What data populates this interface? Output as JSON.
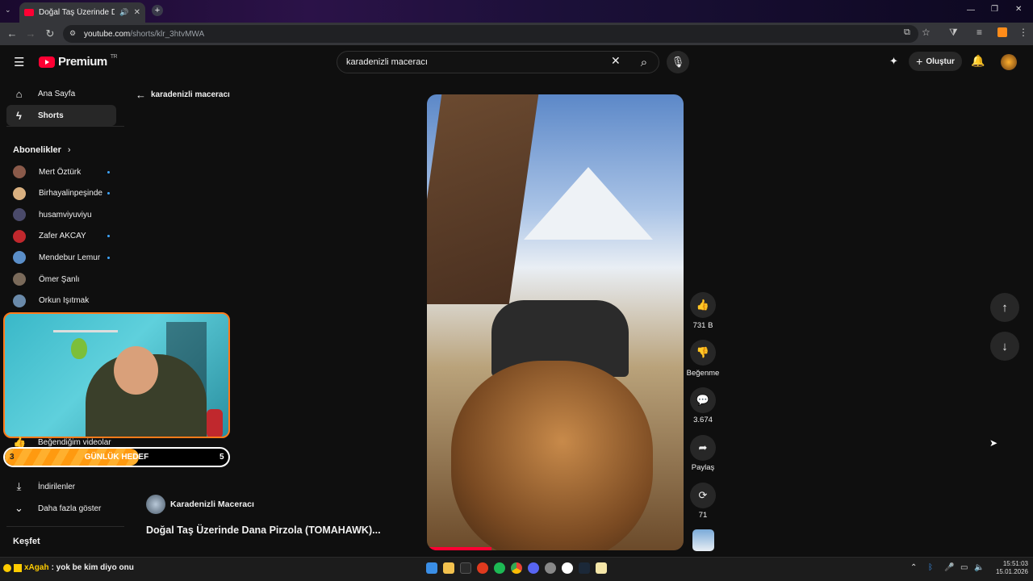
{
  "browser": {
    "tab_title": "Doğal Taş Üzerinde Dana P",
    "url_host": "youtube.com",
    "url_path": "/shorts/klr_3htvMWA"
  },
  "header": {
    "logo_text": "Premium",
    "logo_sup": "TR",
    "search_value": "karadenizli maceracı",
    "create_label": "Oluştur"
  },
  "sidebar": {
    "home": "Ana Sayfa",
    "shorts": "Shorts",
    "subs_title": "Abonelikler",
    "subs": [
      {
        "name": "Mert Öztürk",
        "new": true,
        "color": "#8a5a4a"
      },
      {
        "name": "Birhayalinpeşinde",
        "new": true,
        "color": "#d9b080"
      },
      {
        "name": "husamviyuviyu",
        "new": false,
        "color": "#4a4a6a"
      },
      {
        "name": "Zafer AKCAY",
        "new": true,
        "color": "#c0282d"
      },
      {
        "name": "Mendebur Lemur",
        "new": true,
        "color": "#5a8ec8"
      },
      {
        "name": "Ömer Şanlı",
        "new": false,
        "color": "#7a6a5a"
      },
      {
        "name": "Orkun Işıtmak",
        "new": false,
        "color": "#6a8aaa"
      }
    ],
    "liked": "Beğendiğim videolar",
    "downloads": "İndirilenler",
    "show_more": "Daha fazla göster",
    "explore": "Keşfet"
  },
  "overlay": {
    "goal_left": "3",
    "goal_title": "GÜNLÜK HEDEF",
    "goal_right": "5",
    "goal_progress_fraction": 0.6
  },
  "short": {
    "back_label": "karadenizli maceracı",
    "channel": "Karadenizli Maceracı",
    "title": "Doğal Taş Üzerinde Dana Pirzola (TOMAHAWK)...",
    "likes": "731 B",
    "dislike_label": "Beğenme",
    "comments": "3.674",
    "share_label": "Paylaş",
    "remix_count": "71"
  },
  "chat": {
    "user": "xAgah",
    "message": ": yok be kim diyo onu"
  },
  "clock": {
    "time": "15:51:03",
    "date": "15.01.2026"
  },
  "colors": {
    "accent_red": "#ff0033",
    "webcam_border": "#ff7a1a",
    "goal_fill": "#ffb02e",
    "chat_user": "#ffcc00"
  }
}
